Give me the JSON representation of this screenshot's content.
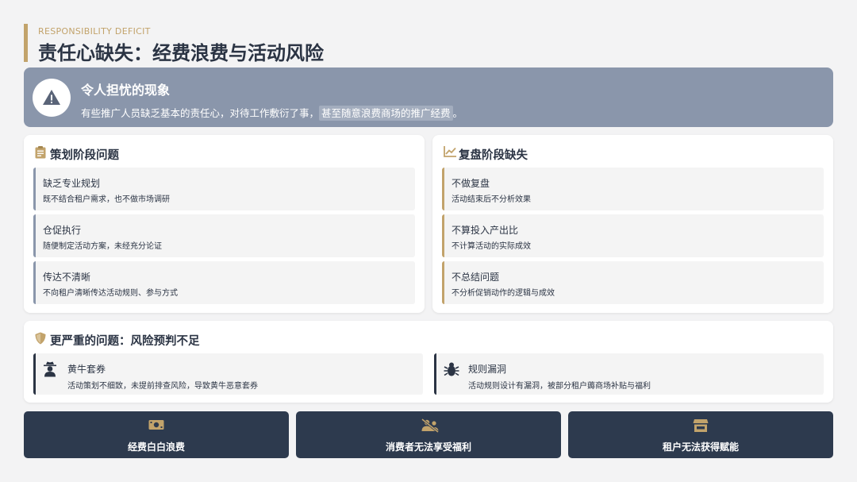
{
  "header": {
    "eyebrow": "RESPONSIBILITY DEFICIT",
    "title": "责任心缺失：经费浪费与活动风险"
  },
  "banner": {
    "icon": "warning-icon",
    "title": "令人担忧的现象",
    "text_prefix": "有些推广人员缺乏基本的责任心，对待工作敷衍了事，",
    "text_highlight": "甚至随意浪费商场的推广经费",
    "text_suffix": "。"
  },
  "planning": {
    "icon": "clipboard-icon",
    "title": "策划阶段问题",
    "items": [
      {
        "title": "缺乏专业规划",
        "desc": "既不结合租户需求，也不做市场调研"
      },
      {
        "title": "仓促执行",
        "desc": "随便制定活动方案，未经充分论证"
      },
      {
        "title": "传达不清晰",
        "desc": "不向租户清晰传达活动规则、参与方式"
      }
    ]
  },
  "review": {
    "icon": "trend-chart-icon",
    "title": "复盘阶段缺失",
    "items": [
      {
        "title": "不做复盘",
        "desc": "活动结束后不分析效果"
      },
      {
        "title": "不算投入产出比",
        "desc": "不计算活动的实际成效"
      },
      {
        "title": "不总结问题",
        "desc": "不分析促销动作的逻辑与成效"
      }
    ]
  },
  "risk": {
    "icon": "shield-icon",
    "title": "更严重的问题：风险预判不足",
    "items": [
      {
        "icon": "user-secret-icon",
        "title": "黄牛套券",
        "desc": "活动策划不细致，未提前排查风险，导致黄牛恶意套券"
      },
      {
        "icon": "bug-icon",
        "title": "规则漏洞",
        "desc": "活动规则设计有漏洞，被部分租户薅商场补贴与福利"
      }
    ]
  },
  "consequences": [
    {
      "icon": "money-icon",
      "label": "经费白白浪费"
    },
    {
      "icon": "users-slash-icon",
      "label": "消费者无法享受福利"
    },
    {
      "icon": "store-icon",
      "label": "租户无法获得赋能"
    }
  ],
  "colors": {
    "accent": "#c2a36b",
    "banner": "#8a96ab",
    "dark": "#2d3a4e",
    "text": "#2b3444"
  }
}
